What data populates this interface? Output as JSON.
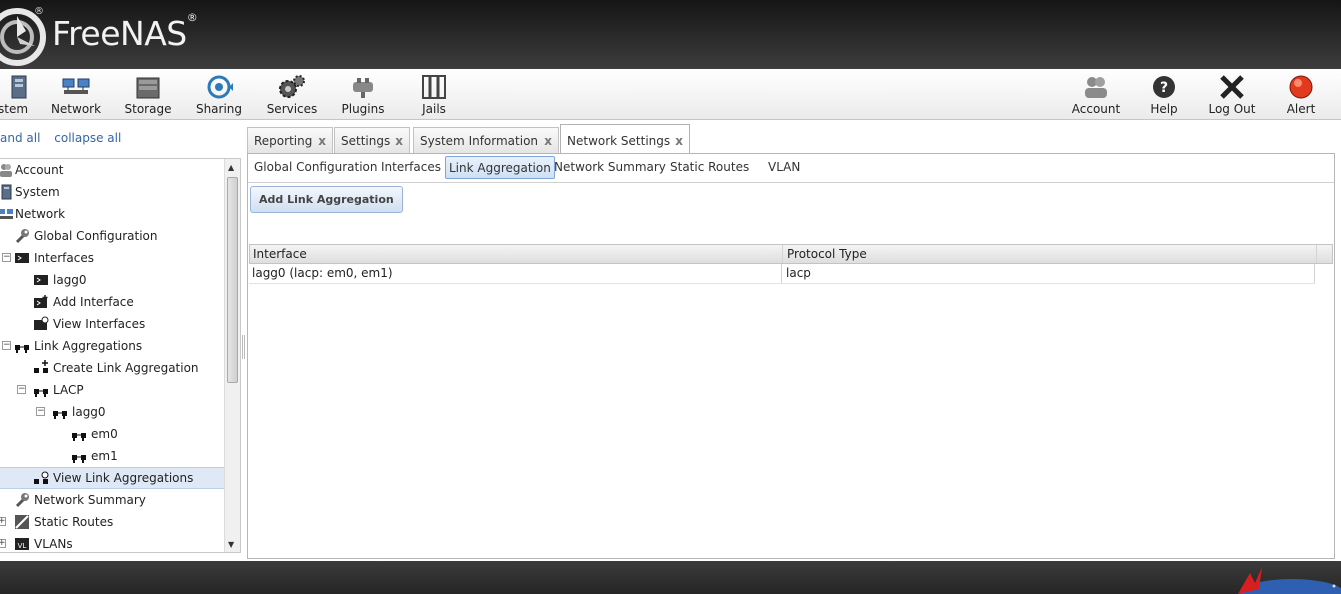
{
  "brand": {
    "name": "FreeNAS",
    "reg": "®"
  },
  "toolbar": {
    "left": [
      {
        "label": "stem",
        "icon": "system-icon"
      },
      {
        "label": "Network",
        "icon": "network-icon"
      },
      {
        "label": "Storage",
        "icon": "storage-icon"
      },
      {
        "label": "Sharing",
        "icon": "sharing-icon"
      },
      {
        "label": "Services",
        "icon": "services-icon"
      },
      {
        "label": "Plugins",
        "icon": "plugins-icon"
      },
      {
        "label": "Jails",
        "icon": "jails-icon"
      }
    ],
    "right": [
      {
        "label": "Account",
        "icon": "account-icon"
      },
      {
        "label": "Help",
        "icon": "help-icon"
      },
      {
        "label": "Log Out",
        "icon": "logout-icon"
      },
      {
        "label": "Alert",
        "icon": "alert-icon"
      }
    ]
  },
  "tree_links": {
    "expand": "and all",
    "collapse": "collapse all"
  },
  "tree": [
    {
      "label": "Account",
      "toggle": "",
      "icon": "account-icon"
    },
    {
      "label": "System",
      "toggle": "",
      "icon": "system-icon"
    },
    {
      "label": "Network",
      "toggle": "",
      "icon": "network-icon"
    },
    {
      "label": "Global Configuration",
      "toggle": "",
      "icon": "wrench-icon"
    },
    {
      "label": "Interfaces",
      "toggle": "−",
      "icon": "interface-icon"
    },
    {
      "label": "lagg0",
      "toggle": "",
      "icon": "interface-icon"
    },
    {
      "label": "Add Interface",
      "toggle": "",
      "icon": "add-interface-icon"
    },
    {
      "label": "View Interfaces",
      "toggle": "",
      "icon": "view-interface-icon"
    },
    {
      "label": "Link Aggregations",
      "toggle": "−",
      "icon": "link-aggregation-icon"
    },
    {
      "label": "Create Link Aggregation",
      "toggle": "",
      "icon": "create-lagg-icon"
    },
    {
      "label": "LACP",
      "toggle": "−",
      "icon": "link-aggregation-icon"
    },
    {
      "label": "lagg0",
      "toggle": "−",
      "icon": "link-aggregation-icon"
    },
    {
      "label": "em0",
      "toggle": "",
      "icon": "link-aggregation-icon"
    },
    {
      "label": "em1",
      "toggle": "",
      "icon": "link-aggregation-icon"
    },
    {
      "label": "View Link Aggregations",
      "toggle": "",
      "icon": "view-lagg-icon",
      "selected": true
    },
    {
      "label": "Network Summary",
      "toggle": "",
      "icon": "wrench-icon"
    },
    {
      "label": "Static Routes",
      "toggle": "+",
      "icon": "static-routes-icon"
    },
    {
      "label": "VLANs",
      "toggle": "+",
      "icon": "vlan-icon"
    }
  ],
  "tabs": [
    {
      "label": "Reporting",
      "close": "x"
    },
    {
      "label": "Settings",
      "close": "x"
    },
    {
      "label": "System Information",
      "close": "x"
    },
    {
      "label": "Network Settings",
      "close": "x",
      "active": true
    }
  ],
  "subtabs": [
    "Global Configuration",
    "Interfaces",
    "Link Aggregation",
    "Network Summary",
    "Static Routes",
    "VLAN"
  ],
  "active_subtab": "Link Aggregation",
  "add_button": "Add Link Aggregation",
  "grid": {
    "columns": [
      "Interface",
      "Protocol Type"
    ],
    "rows": [
      [
        "lagg0 (lacp: em0, em1)",
        "lacp"
      ]
    ]
  },
  "colors": {
    "header_dark": "#151515",
    "selection": "#dfe9f6",
    "accent_blue": "#3366aa"
  }
}
